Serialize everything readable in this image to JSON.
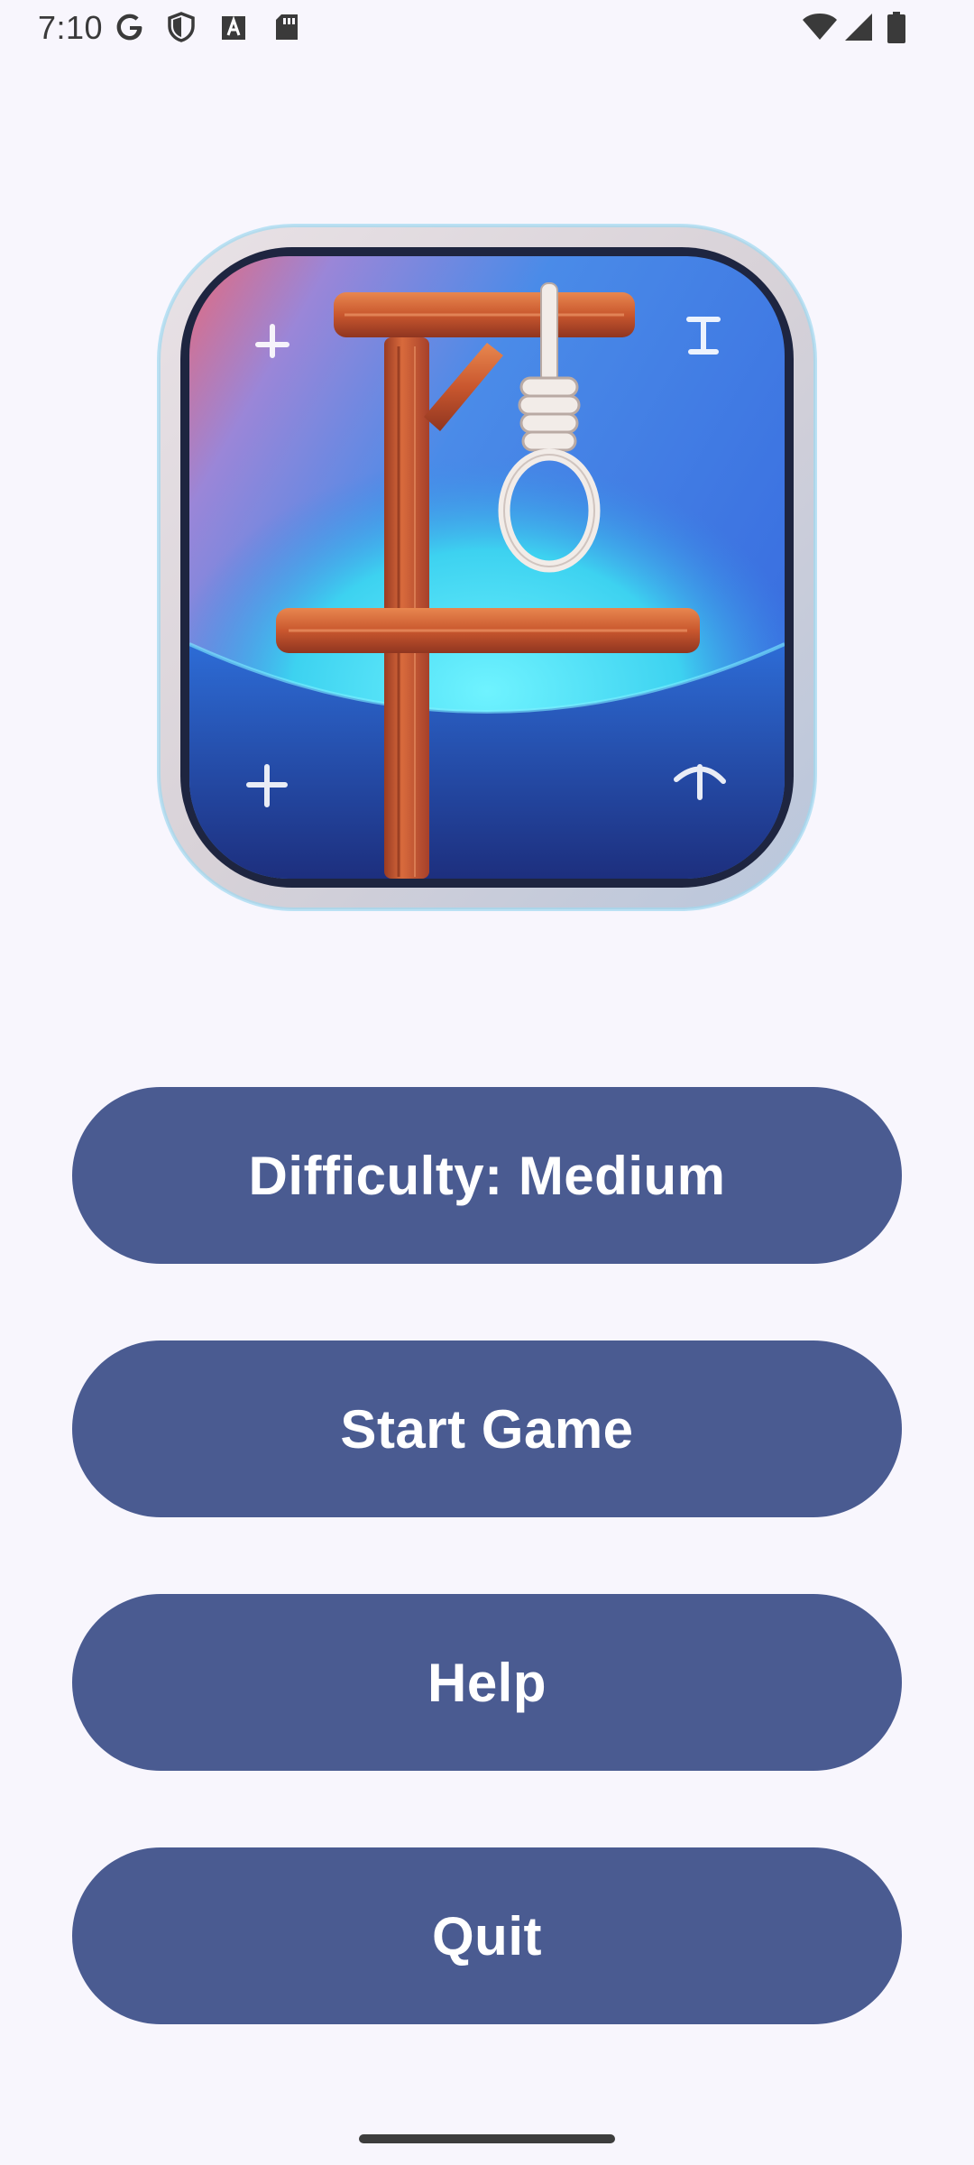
{
  "status_bar": {
    "time": "7:10",
    "icons": [
      "google-icon",
      "shield-icon",
      "font-icon",
      "sd-card-icon",
      "wifi-icon",
      "signal-icon",
      "battery-icon"
    ]
  },
  "logo": {
    "icon": "hangman-gallows-icon"
  },
  "menu": {
    "difficulty_label": "Difficulty: Medium",
    "start_label": "Start Game",
    "help_label": "Help",
    "quit_label": "Quit"
  },
  "colors": {
    "background": "#f8f6fd",
    "button": "#4a5b91",
    "button_text": "#ffffff"
  }
}
